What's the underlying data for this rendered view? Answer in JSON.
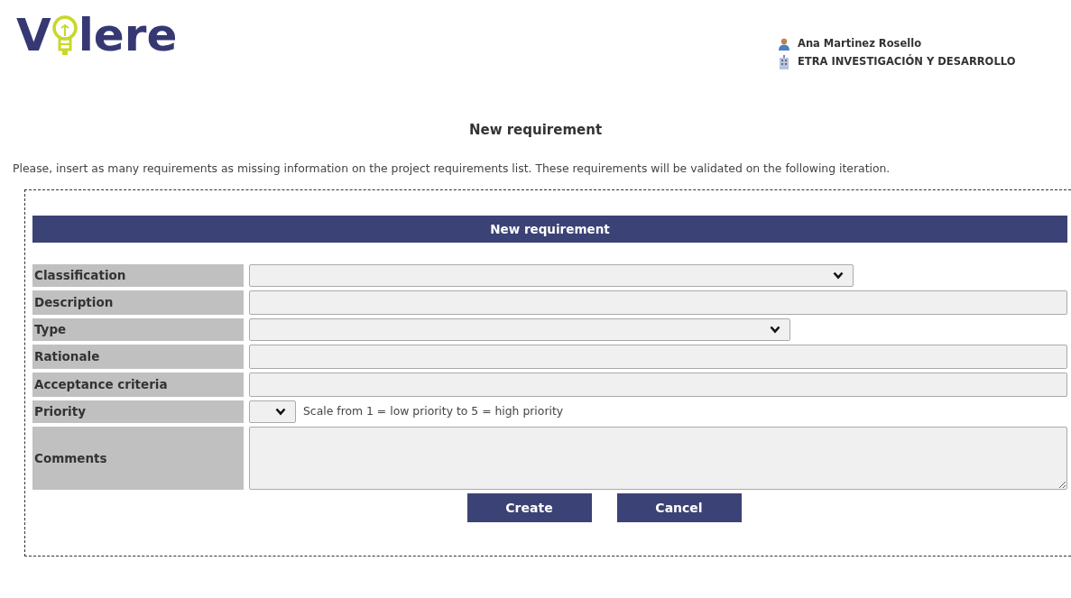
{
  "logo": {
    "before": "V",
    "after": "lere"
  },
  "user": {
    "name": "Ana Martinez Rosello",
    "organization": "ETRA INVESTIGACIÓN Y DESARROLLO"
  },
  "page_title": "New requirement",
  "intro": "Please, insert as many requirements as missing information on the project requirements list. These requirements will be validated on the following iteration.",
  "form": {
    "header": "New requirement",
    "fields": [
      {
        "label": "Classification",
        "kind": "select"
      },
      {
        "label": "Description",
        "kind": "text"
      },
      {
        "label": "Type",
        "kind": "select"
      },
      {
        "label": "Rationale",
        "kind": "text"
      },
      {
        "label": "Acceptance criteria",
        "kind": "text"
      },
      {
        "label": "Priority",
        "kind": "small-select",
        "hint": "Scale from 1 = low priority to 5 = high priority"
      },
      {
        "label": "Comments",
        "kind": "textarea"
      }
    ],
    "buttons": [
      "Create",
      "Cancel"
    ]
  }
}
